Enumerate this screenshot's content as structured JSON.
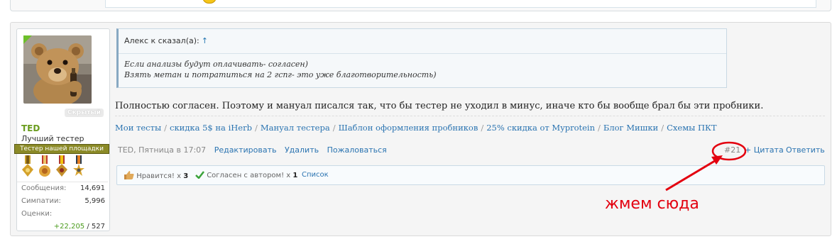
{
  "user": {
    "name": "TED",
    "title": "Лучший тестер",
    "hidden_badge": "Скрытый",
    "banner": "Тестер нашей площадки",
    "stats": [
      {
        "label": "Сообщения:",
        "value": "14,691"
      },
      {
        "label": "Симпатии:",
        "value": "5,996"
      }
    ],
    "rating_label": "Оценки:",
    "rating_positive": "+22,205",
    "rating_rest": " / 527"
  },
  "quote": {
    "author_line": "Алекс к сказал(а):",
    "arrow": "↑",
    "line1": "Если анализы будут оплачивать- согласен)",
    "line2": "Взять метан и потратиться на 2 гспг- это уже благотворительность)"
  },
  "message": "Полностью согласен. Поэтому и мануал писался так, что бы тестер не уходил в минус, иначе кто бы вообще брал бы эти пробники.",
  "signature": {
    "links": [
      "Мои тесты",
      "скидка 5$ на iHerb",
      "Мануал тестера",
      "Шаблон оформления пробников",
      "25% скидка от Myprotein",
      "Блог Мишки",
      "Схемы ПКТ"
    ],
    "separator": "/"
  },
  "meta": {
    "author_date": "TED, Пятница в 17:07",
    "edit": "Редактировать",
    "delete": "Удалить",
    "report": "Пожаловаться",
    "post_number": "#21",
    "quote_btn": "+ Цитата",
    "reply_btn": "Ответить"
  },
  "likes": {
    "liked_label": "Нравится!",
    "liked_count_prefix": " x ",
    "liked_count": "3",
    "agree_label": "Согласен с автором!",
    "agree_count_prefix": " x ",
    "agree_count": "1",
    "list_link": "Список"
  },
  "annotation": {
    "text": "жмем сюда",
    "color": "#e3000f"
  }
}
